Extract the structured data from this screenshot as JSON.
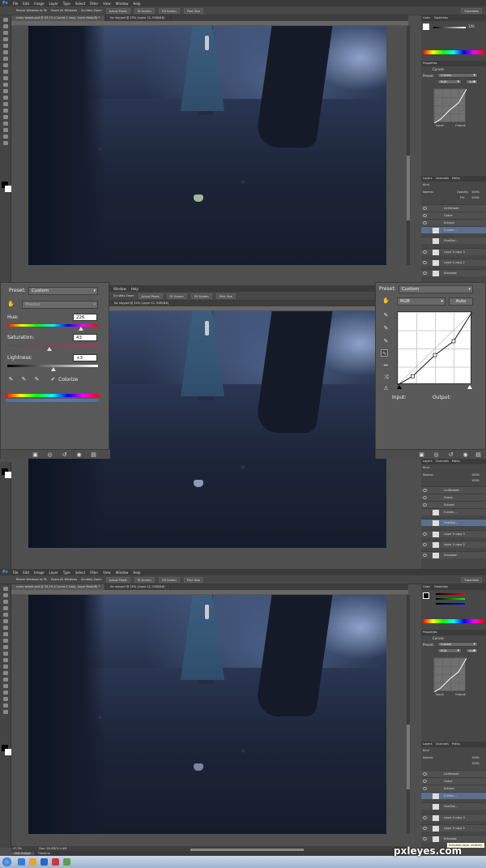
{
  "app": {
    "logo": "Ps",
    "menu": [
      "File",
      "Edit",
      "Image",
      "Layer",
      "Type",
      "Select",
      "Filter",
      "View",
      "Window",
      "Help"
    ],
    "options": [
      "Resize Windows to Fit",
      "Zoom All Windows",
      "Scrubby Zoom",
      "Actual Pixels",
      "Fit Screen",
      "Fill Screen",
      "Print Size"
    ],
    "workspace": "Essentials",
    "doc_tab_1": "scary woods.psd @ 43,1% (Curves 1 copy, Layer Mask/8) *",
    "doc_tab_2": "for sky.psd @ 25% (Layer 12, RGB/8#)",
    "zoom_status": "47,3%",
    "doc_status": "Doc: 26,2M/114,4M",
    "bottom_tabs": [
      "Mini Bridge",
      "Timeline"
    ],
    "tooltip": "Indicates layer visibility"
  },
  "color_panel": {
    "tab1": "Color",
    "tab2": "Swatches",
    "value": "100"
  },
  "properties": {
    "title": "Properties",
    "kind": "Curves",
    "preset_label": "Preset:",
    "preset_value": "Custom",
    "channel": "RGB",
    "auto": "Auto",
    "input": "Input:",
    "output": "Output:"
  },
  "layers": {
    "tabs": [
      "Layers",
      "Channels",
      "Paths"
    ],
    "kind": "Kind",
    "blend": "Normal",
    "opacity_label": "Opacity:",
    "opacity": "100%",
    "fill_label": "Fill:",
    "fill": "100%",
    "items": [
      {
        "name": "Lichtbroad"
      },
      {
        "name": "Grave"
      },
      {
        "name": "Schaon"
      },
      {
        "name": "Curves ..."
      },
      {
        "name": "Hue/Sat..."
      },
      {
        "name": "Layer 0 copy 3"
      },
      {
        "name": "Layer 0 copy 2"
      },
      {
        "name": "Schadow"
      }
    ]
  },
  "hue_sat": {
    "preset_label": "Preset:",
    "preset_value": "Custom",
    "range": "Master",
    "hue_label": "Hue:",
    "hue": "226",
    "hue_level": 0.81,
    "sat_label": "Saturation:",
    "sat": "43",
    "sat_level": 0.46,
    "light_label": "Lightness:",
    "light": "+3",
    "light_level": 0.51,
    "colorize": "Colorize"
  },
  "curves_panel": {
    "preset_label": "Preset:",
    "preset_value": "Custom",
    "channel": "RGB",
    "auto": "Auto",
    "input": "Input:",
    "output": "Output:",
    "points": [
      [
        0,
        0
      ],
      [
        0.2,
        0.12
      ],
      [
        0.5,
        0.41
      ],
      [
        0.75,
        0.6
      ],
      [
        1,
        1
      ]
    ]
  },
  "mid_menu": [
    "Window",
    "Help"
  ],
  "watermark": "pxleyes.com",
  "colors": {
    "accent": "#4aa3ff",
    "selected_layer": "#5d6f8a"
  }
}
